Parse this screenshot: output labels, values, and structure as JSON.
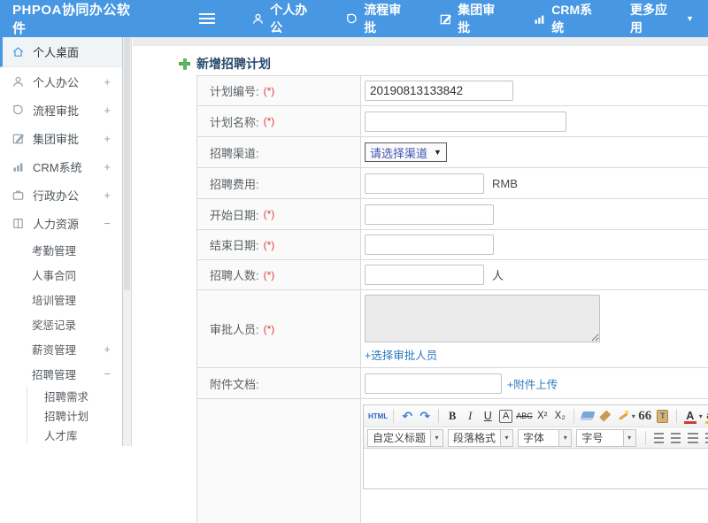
{
  "topbar": {
    "logo": "PHPOA协同办公软件",
    "menu": [
      {
        "label": "个人办公"
      },
      {
        "label": "流程审批"
      },
      {
        "label": "集团审批"
      },
      {
        "label": "CRM系统"
      },
      {
        "label": "更多应用"
      }
    ]
  },
  "sidebar": {
    "items": [
      {
        "label": "个人桌面"
      },
      {
        "label": "个人办公",
        "expand": "+"
      },
      {
        "label": "流程审批",
        "expand": "+"
      },
      {
        "label": "集团审批",
        "expand": "+"
      },
      {
        "label": "CRM系统",
        "expand": "+"
      },
      {
        "label": "行政办公",
        "expand": "+"
      },
      {
        "label": "人力资源",
        "expand": "−"
      }
    ],
    "hr_children": [
      {
        "label": "考勤管理"
      },
      {
        "label": "人事合同"
      },
      {
        "label": "培训管理"
      },
      {
        "label": "奖惩记录"
      },
      {
        "label": "薪资管理",
        "expand": "+"
      },
      {
        "label": "招聘管理",
        "expand": "−"
      }
    ],
    "recruit_children": [
      {
        "label": "招聘需求"
      },
      {
        "label": "招聘计划"
      },
      {
        "label": "人才库"
      }
    ]
  },
  "main": {
    "title": "新增招聘计划",
    "form": {
      "rows": [
        {
          "label": "计划编号:",
          "required": "(*)",
          "value": "20190813133842"
        },
        {
          "label": "计划名称:",
          "required": "(*)"
        },
        {
          "label": "招聘渠道:",
          "select_value": "请选择渠道"
        },
        {
          "label": "招聘费用:",
          "suffix": "RMB"
        },
        {
          "label": "开始日期:",
          "required": "(*)"
        },
        {
          "label": "结束日期:",
          "required": "(*)"
        },
        {
          "label": "招聘人数:",
          "required": "(*)",
          "suffix": "人"
        },
        {
          "label": "审批人员:",
          "required": "(*)",
          "link": "+选择审批人员"
        },
        {
          "label": "附件文档:",
          "link": "+附件上传"
        }
      ]
    },
    "editor": {
      "source_label": "HTML",
      "bold": "B",
      "italic": "I",
      "underline": "U",
      "font_border": "A",
      "strike": "ABC",
      "superscript": "X²",
      "subscript": "X₂",
      "quote": "66",
      "paste_letter": "T",
      "font_color": "A",
      "highlight": "ab",
      "dropdowns": [
        {
          "label": "自定义标题"
        },
        {
          "label": "段落格式"
        },
        {
          "label": "字体"
        },
        {
          "label": "字号"
        }
      ]
    }
  },
  "colors": {
    "topbar_blue": "#4797e2",
    "link_blue": "#2d79c3",
    "required_red": "#e03e3e",
    "title_navy": "#2a4a6d",
    "plus_green": "#5cb85c"
  }
}
